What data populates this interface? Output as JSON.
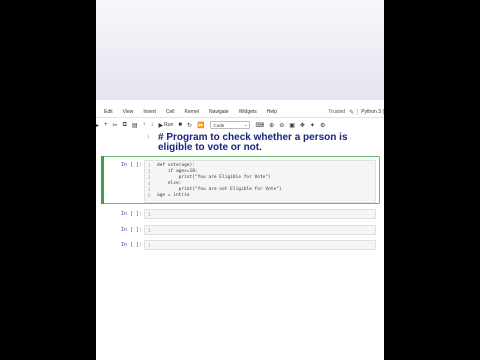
{
  "menu": {
    "items": [
      "Edit",
      "View",
      "Insert",
      "Cell",
      "Kernel",
      "Navigate",
      "Widgets",
      "Help"
    ],
    "trusted": "Trusted",
    "kernel_name": "Python 3 ("
  },
  "toolbar": {
    "run_label": "Run",
    "cell_type": "Code"
  },
  "cells": {
    "markdown": {
      "line_number": "1",
      "text": "# Program to check whether a person is eligible to vote or not."
    },
    "code": {
      "prompt": "In [ ]:",
      "line_numbers": [
        "1",
        "2",
        "3",
        "4",
        "5",
        "6"
      ],
      "lines": [
        "def vote(age):",
        "    if age>=18:",
        "        print(\"You are Eligible for Vote\")",
        "    else:",
        "        print(\"You are not Eligible for Vote\")",
        "age = int(in"
      ]
    },
    "empty": [
      {
        "prompt": "In [ ]:",
        "line_number": "1"
      },
      {
        "prompt": "In [ ]:",
        "line_number": "1"
      },
      {
        "prompt": "In [ ]:",
        "line_number": "1"
      }
    ]
  }
}
